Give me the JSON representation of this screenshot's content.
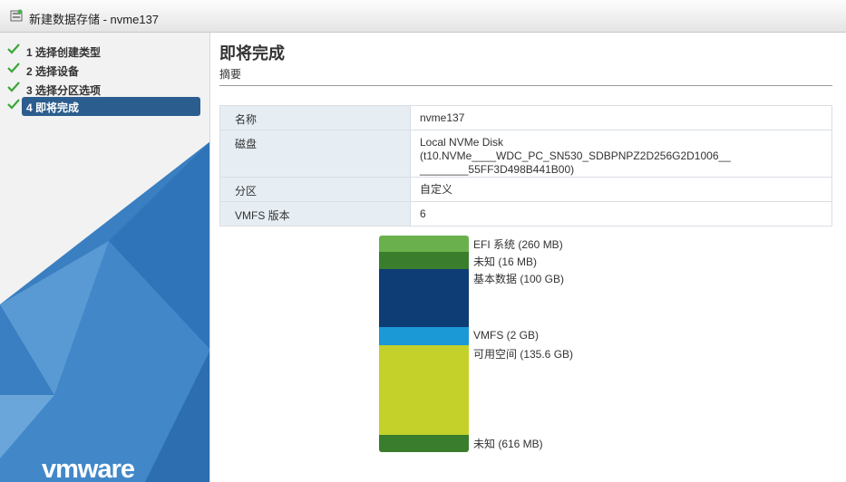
{
  "titlebar": {
    "title": "新建数据存储 - nvme137"
  },
  "sidebar": {
    "steps": [
      {
        "label": "1 选择创建类型",
        "done": true
      },
      {
        "label": "2 选择设备",
        "done": true
      },
      {
        "label": "3 选择分区选项",
        "done": true
      },
      {
        "label": "4 即将完成",
        "done": true,
        "active": true
      }
    ],
    "logo": "vmware"
  },
  "main": {
    "title": "即将完成",
    "subtitle": "摘要",
    "summary": [
      {
        "key": "名称",
        "value": "nvme137"
      },
      {
        "key": "磁盘",
        "value": "Local NVMe Disk (t10.NVMe____WDC_PC_SN530_SDBPNPZ2D256G2D1006__ ________55FF3D498B441B00)"
      },
      {
        "key": "分区",
        "value": "自定义"
      },
      {
        "key": "VMFS 版本",
        "value": "6"
      }
    ]
  },
  "partitions": [
    {
      "label": "EFI 系统  (260 MB)",
      "color": "#6ab04c"
    },
    {
      "label": "未知  (16 MB)",
      "color": "#3a7d2c"
    },
    {
      "label": "基本数据  (100 GB)",
      "color": "#0e3c75"
    },
    {
      "label": "VMFS  (2 GB)",
      "color": "#1a99d6"
    },
    {
      "label": "可用空间  (135.6 GB)",
      "color": "#c3d12a"
    },
    {
      "label": "未知  (616 MB)",
      "color": "#3a7d2c"
    }
  ]
}
